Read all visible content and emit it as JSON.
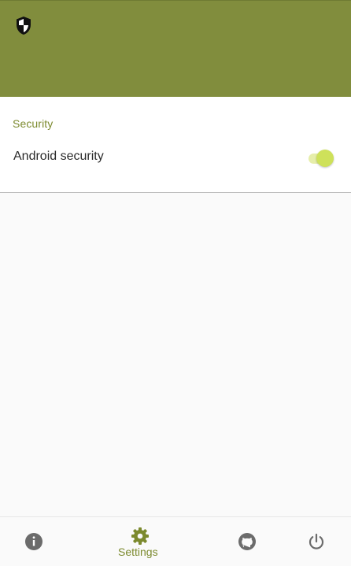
{
  "header": {
    "icon": "shield-icon",
    "background_color": "#818d3d"
  },
  "settings": {
    "section_title": "Security",
    "rows": [
      {
        "label": "Android security",
        "control": "toggle-switch",
        "enabled": true
      }
    ]
  },
  "bottom_nav": {
    "active_color": "#7c8a2e",
    "inactive_color": "#6b6b6b",
    "items": [
      {
        "icon": "info-icon",
        "label": "",
        "active": false
      },
      {
        "icon": "gear-icon",
        "label": "Settings",
        "active": true
      },
      {
        "icon": "github-icon",
        "label": "",
        "active": false
      },
      {
        "icon": "power-icon",
        "label": "",
        "active": false
      }
    ]
  }
}
